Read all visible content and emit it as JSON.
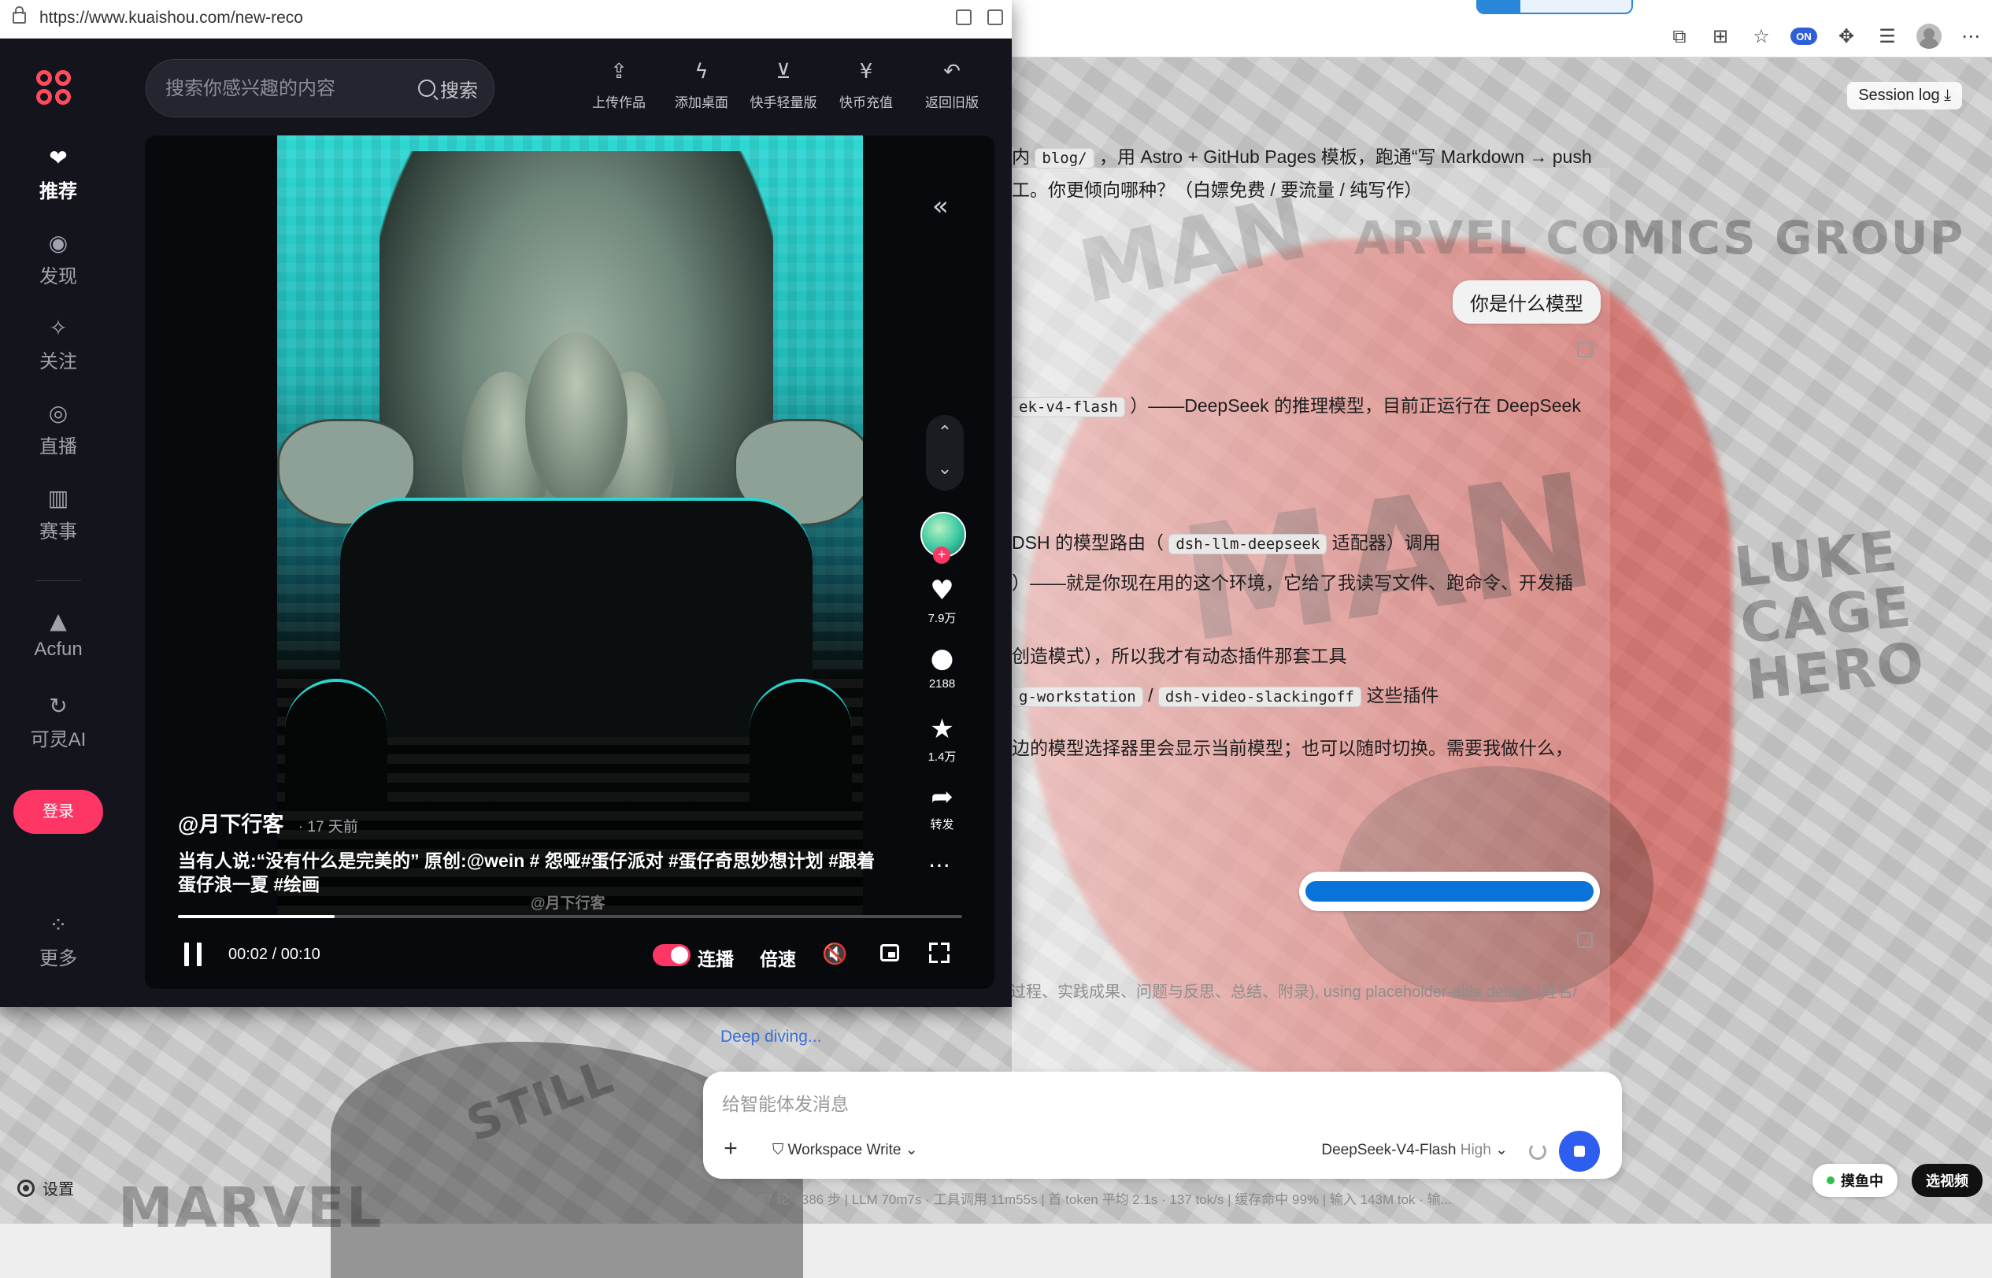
{
  "popup": {
    "url": "https://www.kuaishou.com/new-reco",
    "search": {
      "placeholder": "搜索你感兴趣的内容",
      "button": "搜索"
    },
    "top_actions": [
      "上传作品",
      "添加桌面",
      "快手轻量版",
      "快币充值",
      "返回旧版"
    ],
    "sidebar": {
      "items": [
        {
          "label": "推荐",
          "icon": "tv-icon",
          "active": true
        },
        {
          "label": "发现",
          "icon": "eye-icon"
        },
        {
          "label": "关注",
          "icon": "sparkle-icon"
        },
        {
          "label": "直播",
          "icon": "live-icon"
        },
        {
          "label": "赛事",
          "icon": "trophy-icon"
        },
        {
          "label": "Acfun",
          "icon": "acfun-icon"
        },
        {
          "label": "可灵AI",
          "icon": "kling-icon"
        }
      ],
      "login": "登录",
      "more": "更多"
    },
    "video": {
      "author": "@月下行客",
      "time_ago": "· 17 天前",
      "caption": "当有人说:“没有什么是完美的” 原创:@wein # 怨哑#蛋仔派对 #蛋仔奇思妙想计划 #跟着蛋仔浪一夏 #绘画",
      "watermark": "@月下行客",
      "likes": "7.9万",
      "comments": "2188",
      "favorites": "1.4万",
      "share": "转发",
      "progress": 0.2,
      "current_time": "00:02",
      "duration": "00:10",
      "autoplay_label": "连播",
      "speed_label": "倍速"
    }
  },
  "background": {
    "session_log": "Session log",
    "chat": {
      "line1_pre": "内",
      "line1_code": "blog/",
      "line1_post": "，用 Astro + GitHub Pages 模板，跑通“写 Markdown → push",
      "line2": "工。你更倾向哪种？（白嫖免费 / 要流量 / 纯写作）",
      "user_question": "你是什么模型",
      "a1_code": "ek-v4-flash",
      "a1_post": "）——DeepSeek 的推理模型，目前正运行在 DeepSeek",
      "a2_pre": "DSH 的模型路由（",
      "a2_code": "dsh-llm-deepseek",
      "a2_post": "适配器）调用",
      "a3": "）——就是你现在用的这个环境，它给了我读写文件、跑命令、开发插",
      "a4": "创造模式），所以我才有动态插件那套工具",
      "a5_code1": "g-workstation",
      "a5_sep": "/",
      "a5_code2": "dsh-video-slackingoff",
      "a5_post": "这些插件",
      "a6": "边的模型选择器里会显示当前模型；也可以随时切换。需要我做什么，",
      "faint": "过程、实践成果、问题与反思、总结、附录), using placeholder-able details (姓名/",
      "deep_diving": "Deep diving..."
    },
    "composer": {
      "placeholder": "给智能体发消息",
      "mode": "Workspace Write",
      "model": "DeepSeek-V4-Flash",
      "level": "High"
    },
    "stats": "67 轮 · 386 步  |  LLM 70m7s · 工具调用 11m55s  |  首 token 平均 2.1s · 137 tok/s  |  缓存命中 99%  |  输入 143M tok · 输...",
    "settings": "设置",
    "status_pill": "摸鱼中",
    "video_pill": "选视频",
    "extension_badge": "ON"
  },
  "colors": {
    "kuaishou_red": "#fe3666",
    "send_blue": "#2d5ef0",
    "popup_bg": "#14151c"
  }
}
